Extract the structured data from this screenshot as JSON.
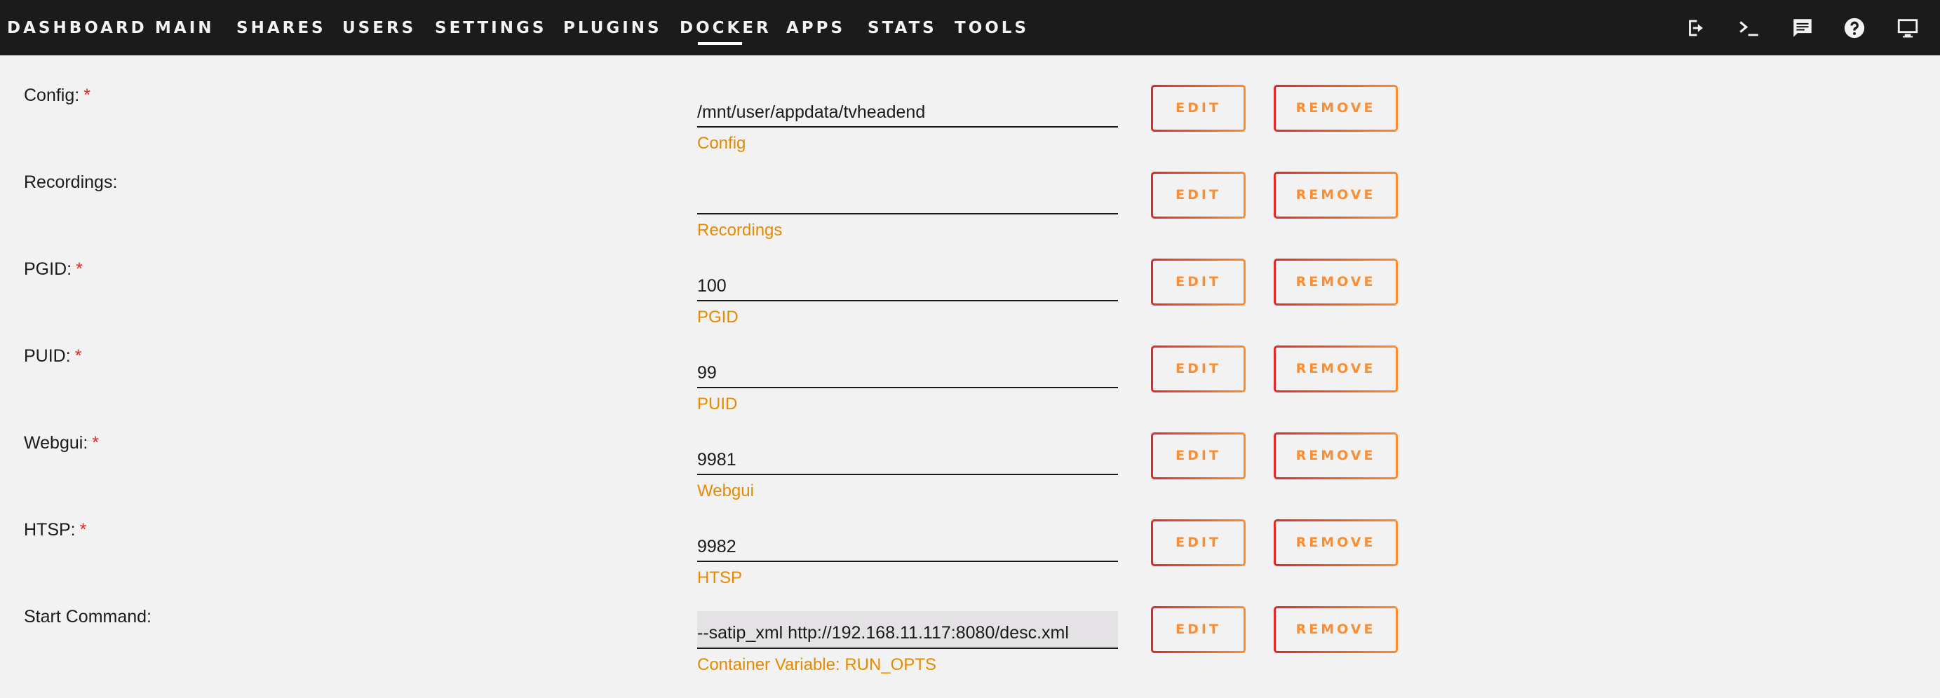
{
  "nav": {
    "items": [
      {
        "label": "DASHBOARD",
        "active": false
      },
      {
        "label": "MAIN",
        "active": false
      },
      {
        "label": "SHARES",
        "active": false
      },
      {
        "label": "USERS",
        "active": false
      },
      {
        "label": "SETTINGS",
        "active": false
      },
      {
        "label": "PLUGINS",
        "active": false
      },
      {
        "label": "DOCKER",
        "active": true
      },
      {
        "label": "APPS",
        "active": false
      },
      {
        "label": "STATS",
        "active": false
      },
      {
        "label": "TOOLS",
        "active": false
      }
    ],
    "icons": [
      "logout-icon",
      "terminal-icon",
      "feedback-icon",
      "help-icon",
      "monitor-icon"
    ]
  },
  "colors": {
    "topbar": "#1c1b1b",
    "background": "#f2f2f2",
    "required": "#e22828",
    "description": "#e68a00",
    "button_gradient_start": "#e22828",
    "button_gradient_end": "#ff8c2f"
  },
  "required_mark": "*",
  "buttons": {
    "edit_label": "EDIT",
    "remove_label": "REMOVE"
  },
  "fields": [
    {
      "label": "Config:",
      "required": true,
      "value": "/mnt/user/appdata/tvheadend",
      "description": "Config"
    },
    {
      "label": "Recordings:",
      "required": false,
      "value": "",
      "description": "Recordings"
    },
    {
      "label": "PGID:",
      "required": true,
      "value": "100",
      "description": "PGID"
    },
    {
      "label": "PUID:",
      "required": true,
      "value": "99",
      "description": "PUID"
    },
    {
      "label": "Webgui:",
      "required": true,
      "value": "9981",
      "description": "Webgui"
    },
    {
      "label": "HTSP:",
      "required": true,
      "value": "9982",
      "description": "HTSP"
    },
    {
      "label": "Start Command:",
      "required": false,
      "value": "--satip_xml http://192.168.11.117:8080/desc.xml",
      "description": "Container Variable: RUN_OPTS"
    }
  ]
}
